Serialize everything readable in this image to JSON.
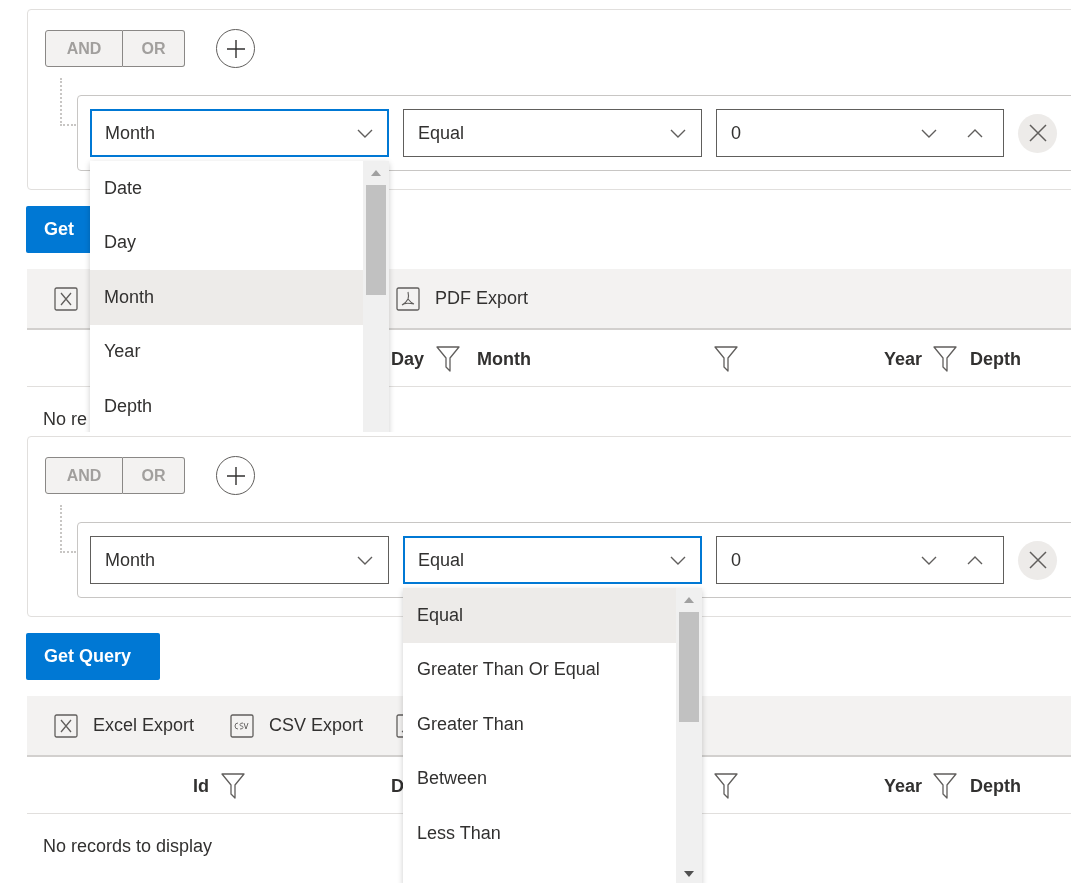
{
  "panels": [
    {
      "logic_buttons": [
        {
          "label": "AND"
        },
        {
          "label": "OR"
        }
      ],
      "rule": {
        "field": {
          "value": "Month",
          "focused": true,
          "options": [
            {
              "label": "Date",
              "selected": false
            },
            {
              "label": "Day",
              "selected": false
            },
            {
              "label": "Month",
              "selected": true
            },
            {
              "label": "Year",
              "selected": false
            },
            {
              "label": "Depth",
              "selected": false
            }
          ]
        },
        "operator": {
          "value": "Equal",
          "focused": false
        },
        "value": "0"
      },
      "query_button": "Get",
      "toolbar": [
        {
          "kind": "excel"
        },
        {
          "kind": "pdf",
          "label": "PDF Export"
        }
      ],
      "columns": [
        {
          "filter": false
        },
        {
          "label": "Day",
          "filter": true
        },
        {
          "label": "Month",
          "filter": true
        },
        {
          "label": "Year",
          "filter": true
        },
        {
          "label": "Depth",
          "filter": false
        }
      ],
      "empty_message": "No re"
    },
    {
      "logic_buttons": [
        {
          "label": "AND"
        },
        {
          "label": "OR"
        }
      ],
      "rule": {
        "field": {
          "value": "Month",
          "focused": false
        },
        "operator": {
          "value": "Equal",
          "focused": true,
          "options": [
            {
              "label": "Equal",
              "selected": true
            },
            {
              "label": "Greater Than Or Equal",
              "selected": false
            },
            {
              "label": "Greater Than",
              "selected": false
            },
            {
              "label": "Between",
              "selected": false
            },
            {
              "label": "Less Than",
              "selected": false
            }
          ]
        },
        "value": "0"
      },
      "query_button": "Get Query",
      "toolbar": [
        {
          "kind": "excel",
          "label": "Excel Export"
        },
        {
          "kind": "csv",
          "label": "CSV Export"
        },
        {
          "kind": "pdf"
        }
      ],
      "columns": [
        {
          "label": "Id",
          "filter": true
        },
        {
          "label": "D",
          "filter": false
        },
        {
          "filter": true
        },
        {
          "label": "Year",
          "filter": true
        },
        {
          "label": "Depth",
          "filter": false
        }
      ],
      "empty_message": "No records to display"
    }
  ]
}
